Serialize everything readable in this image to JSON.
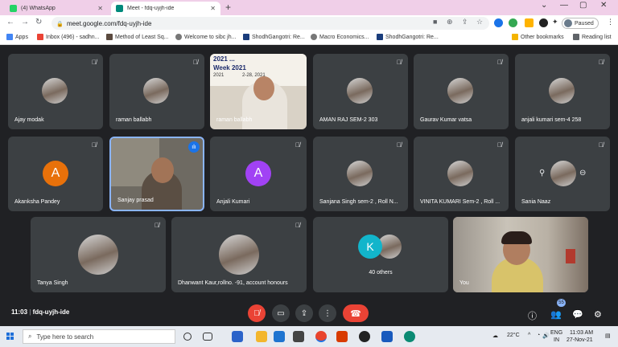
{
  "browser": {
    "tabs": [
      {
        "title": "(4) WhatsApp",
        "favicon_color": "#25d366"
      },
      {
        "title": "Meet - fdq-uyjh-ide",
        "favicon_color": "#00897b"
      }
    ],
    "url": "meet.google.com/fdq-uyjh-ide",
    "profile_label": "Paused",
    "bookmarks": [
      {
        "label": "Apps",
        "icon_color": "#4285f4"
      },
      {
        "label": "Inbox (496) - sadhn...",
        "icon_color": "#ea4335"
      },
      {
        "label": "Method of Least Sq...",
        "icon_color": "#5b4a3f"
      },
      {
        "label": "Welcome to sibc jh...",
        "icon_color": "#777777"
      },
      {
        "label": "ShodhGangotri: Re...",
        "icon_color": "#1a3d7c"
      },
      {
        "label": "Macro Economics...",
        "icon_color": "#777777"
      },
      {
        "label": "ShodhGangotri: Re...",
        "icon_color": "#1a3d7c"
      },
      {
        "label": "Other bookmarks",
        "icon_color": "#f4b400"
      },
      {
        "label": "Reading list",
        "icon_color": "#5f6368"
      }
    ]
  },
  "participants": [
    {
      "name": "Ajay modak"
    },
    {
      "name": "raman ballabh"
    },
    {
      "name": "raman ballabh"
    },
    {
      "name": "AMAN RAJ SEM-2 303"
    },
    {
      "name": "Gaurav Kumar vatsa"
    },
    {
      "name": "anjali kumari sem-4 258"
    },
    {
      "name": "Akanksha Pandey",
      "initial": "A",
      "avatar_color": "#e8710a"
    },
    {
      "name": "Sanjay prasad"
    },
    {
      "name": "Anjali Kumari",
      "initial": "A",
      "avatar_color": "#a142f4"
    },
    {
      "name": "Sanjana Singh sem-2 , Roll N..."
    },
    {
      "name": "VINITA KUMARI Sem-2 , Roll ..."
    },
    {
      "name": "Sania Naaz"
    },
    {
      "name": "Tanya Singh"
    },
    {
      "name": "Dhanwant Kaur,rollno. -91, account honours"
    },
    {
      "name": "40 others",
      "initial": "K",
      "avatar_color": "#12b5cb"
    },
    {
      "name": "You"
    }
  ],
  "presenter_banner": {
    "lines": [
      "2021 ...",
      "Week 2021",
      "2021",
      "2-28, 2021"
    ]
  },
  "meeting": {
    "time": "11:03",
    "code": "fdq-uyjh-ide",
    "people_count": "55"
  },
  "taskbar": {
    "search_placeholder": "Type here to search",
    "temperature": "22°C",
    "language": "ENG",
    "region": "IN",
    "time": "11:03 AM",
    "date": "27-Nov-21"
  },
  "colors": {
    "meet_bg": "#202124",
    "tile_bg": "#3c4043",
    "accent_red": "#ea4335",
    "speaking_border": "#8ab4f8"
  }
}
